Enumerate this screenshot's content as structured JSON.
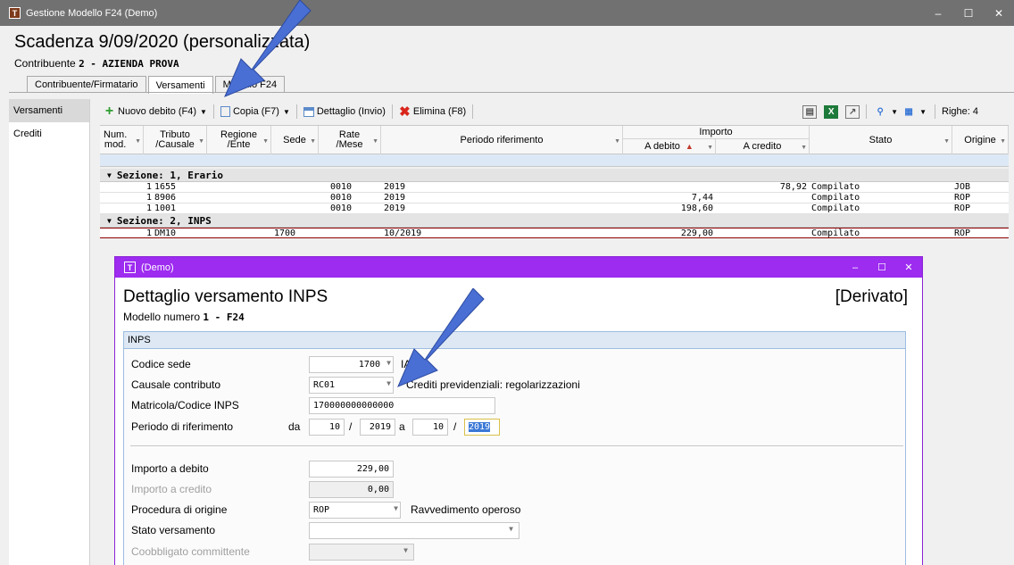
{
  "window": {
    "title": "Gestione Modello F24  (Demo)"
  },
  "header": {
    "title": "Scadenza  9/09/2020 (personalizzata)",
    "contribuente_label": "Contribuente",
    "contribuente_value": "2 - AZIENDA PROVA"
  },
  "tabs": [
    "Contribuente/Firmatario",
    "Versamenti",
    "Modello F24"
  ],
  "sidenav": [
    "Versamenti",
    "Crediti"
  ],
  "toolbar": {
    "new_debit": "Nuovo debito (F4)",
    "copy": "Copia (F7)",
    "detail": "Dettaglio (Invio)",
    "delete": "Elimina (F8)",
    "rows_label": "Righe: 4"
  },
  "grid": {
    "headers": {
      "num": "Num.\nmod.",
      "tributo": "Tributo\n/Causale",
      "regione": "Regione\n/Ente",
      "sede": "Sede",
      "rate": "Rate\n/Mese",
      "periodo": "Periodo riferimento",
      "importo": "Importo",
      "debito": "A debito",
      "credito": "A credito",
      "stato": "Stato",
      "origine": "Origine"
    },
    "sections": [
      {
        "label": "Sezione: 1, Erario",
        "rows": [
          {
            "num": "1",
            "tributo": "1655",
            "regione": "",
            "sede": "",
            "rate": "0010",
            "periodo": "2019",
            "debito": "",
            "credito": "78,92",
            "stato": "Compilato",
            "origine": "JOB"
          },
          {
            "num": "1",
            "tributo": "8906",
            "regione": "",
            "sede": "",
            "rate": "0010",
            "periodo": "2019",
            "debito": "7,44",
            "credito": "",
            "stato": "Compilato",
            "origine": "ROP"
          },
          {
            "num": "1",
            "tributo": "1001",
            "regione": "",
            "sede": "",
            "rate": "0010",
            "periodo": "2019",
            "debito": "198,60",
            "credito": "",
            "stato": "Compilato",
            "origine": "ROP"
          }
        ]
      },
      {
        "label": "Sezione: 2, INPS",
        "rows": [
          {
            "num": "1",
            "tributo": "DM10",
            "regione": "",
            "sede": "1700",
            "rate": "",
            "periodo": "10/2019",
            "debito": "229,00",
            "credito": "",
            "stato": "Compilato",
            "origine": "ROP"
          }
        ]
      }
    ]
  },
  "dialog": {
    "title": "(Demo)",
    "heading": "Dettaglio versamento INPS",
    "tag": "[Derivato]",
    "model_label": "Modello numero",
    "model_value": "1 - F24",
    "group": "INPS",
    "fields": {
      "codice_sede": {
        "label": "Codice sede",
        "value": "1700",
        "desc": "IARI"
      },
      "causale": {
        "label": "Causale contributo",
        "value": "RC01",
        "desc": "Crediti previdenziali: regolarizzazioni"
      },
      "matricola": {
        "label": "Matricola/Codice INPS",
        "value": "170000000000000"
      },
      "periodo": {
        "label": "Periodo di riferimento",
        "da": "da",
        "a": "a",
        "m1": "10",
        "y1": "2019",
        "m2": "10",
        "y2": "2019",
        "slash": "/"
      },
      "importo_debito": {
        "label": "Importo a debito",
        "value": "229,00"
      },
      "importo_credito": {
        "label": "Importo a credito",
        "value": "0,00"
      },
      "procedura": {
        "label": "Procedura di origine",
        "value": "ROP",
        "desc": "Ravvedimento operoso"
      },
      "stato": {
        "label": "Stato versamento",
        "value": ""
      },
      "coobbligato": {
        "label": "Coobbligato committente",
        "value": ""
      }
    }
  },
  "colors": {
    "dialog_title": "#9d2bf0",
    "arrow": "#4a6fd4",
    "titlebar": "#717171"
  }
}
